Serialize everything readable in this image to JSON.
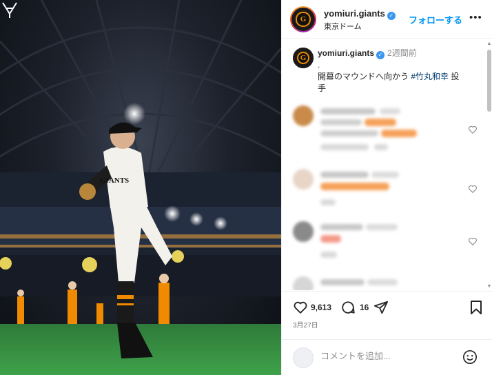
{
  "header": {
    "username": "yomiuri.giants",
    "location": "東京ドーム",
    "follow_label": "フォローする",
    "more_icon": "more-icon"
  },
  "caption": {
    "username": "yomiuri.giants",
    "age": "2週間前",
    "line1": ".",
    "line2_prefix": "開幕のマウンドへ向かう ",
    "hashtag": "#竹丸和幸",
    "line2_suffix": " 投",
    "line3": "手"
  },
  "actions": {
    "likes": "9,613",
    "comments": "16",
    "date": "3月27日"
  },
  "add_comment": {
    "placeholder": "コメントを追加..."
  },
  "colors": {
    "accent": "#0095f6",
    "hashtag": "#00376b",
    "verified": "#3897f0",
    "brand_orange": "#f08a00"
  }
}
